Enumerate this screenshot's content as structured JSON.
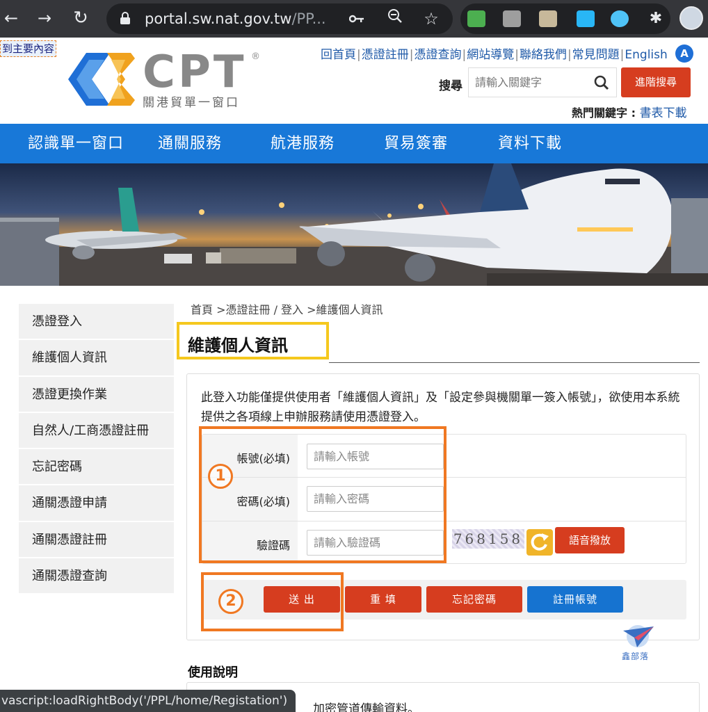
{
  "browser": {
    "url_host": "portal.sw.nat.gov.tw",
    "url_path": "/PP...",
    "status_url": "vascript:loadRightBody('/PPL/home/Registation')"
  },
  "site": {
    "skip_link": "到主要內容",
    "logo_text": "CPT",
    "logo_reg": "®",
    "logo_sub": "關港貿單一窗口",
    "top_links": [
      "回首頁",
      "憑證註冊",
      "憑證查詢",
      "網站導覽",
      "聯絡我們",
      "常見問題",
      "English"
    ],
    "a_badge": "A",
    "search_label": "搜尋",
    "search_placeholder": "請輸入關鍵字",
    "advanced_search": "進階搜尋",
    "hot_keywords_label": "熱門關鍵字 :",
    "hot_keyword": "書表下載",
    "nav": [
      "認識單一窗口",
      "通關服務",
      "航港服務",
      "貿易簽審",
      "資料下載"
    ]
  },
  "sidebar": {
    "items": [
      "憑證登入",
      "維護個人資訊",
      "憑證更換作業",
      "自然人/工商憑證註冊",
      "忘記密碼",
      "通關憑證申請",
      "通關憑證註冊",
      "通關憑證查詢"
    ]
  },
  "content": {
    "breadcrumb": "首頁 >憑證註冊 / 登入 >維護個人資訊",
    "title": "維護個人資訊",
    "notice": "此登入功能僅提供使用者「維護個人資訊」及「設定參與機關單一簽入帳號」，欲使用本系統提供之各項線上申辦服務請使用憑證登入。",
    "form": {
      "account_label": "帳號(必填)",
      "account_placeholder": "請輸入帳號",
      "password_label": "密碼(必填)",
      "password_placeholder": "請輸入密碼",
      "captcha_label": "驗證碼",
      "captcha_placeholder": "請輸入驗證碼",
      "captcha_value": "768158",
      "voice_button": "語音撥放"
    },
    "buttons": {
      "submit": "送 出",
      "reset": "重 填",
      "forgot": "忘記密碼",
      "register": "註冊帳號"
    },
    "annotations": [
      "1",
      "2"
    ],
    "watermark": "鑫部落",
    "usage_title": "使用說明",
    "usage_partial": "加密管道傳輸資料。"
  },
  "colors": {
    "nav_blue": "#1878d8",
    "action_red": "#d63d1f",
    "register_blue": "#1673d0",
    "annotation_orange": "#f07822",
    "title_highlight": "#f5c81e"
  }
}
